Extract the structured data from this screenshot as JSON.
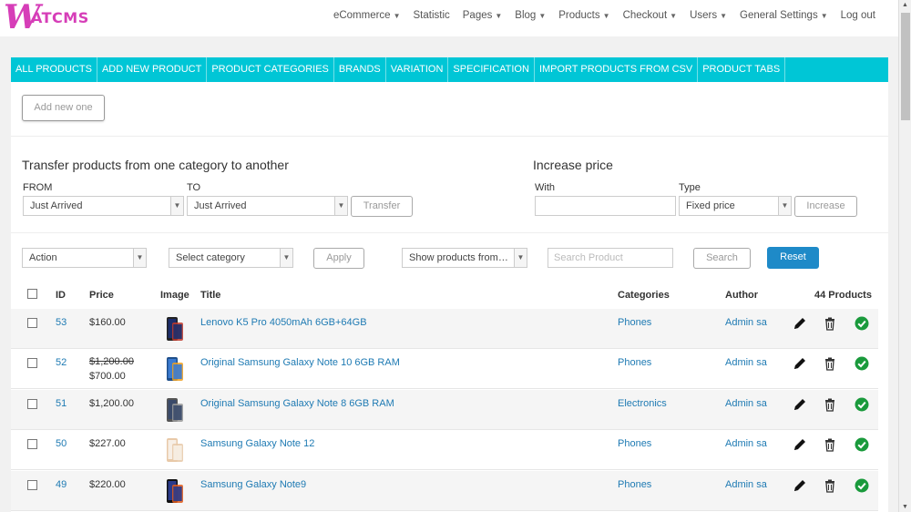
{
  "logo": {
    "initial": "W",
    "rest": "ATCMS"
  },
  "nav": [
    {
      "label": "eCommerce",
      "dropdown": true
    },
    {
      "label": "Statistic",
      "dropdown": false
    },
    {
      "label": "Pages",
      "dropdown": true
    },
    {
      "label": "Blog",
      "dropdown": true
    },
    {
      "label": "Products",
      "dropdown": true
    },
    {
      "label": "Checkout",
      "dropdown": true
    },
    {
      "label": "Users",
      "dropdown": true
    },
    {
      "label": "General Settings",
      "dropdown": true
    },
    {
      "label": "Log out",
      "dropdown": false
    }
  ],
  "tabs": [
    "ALL PRODUCTS",
    "ADD NEW PRODUCT",
    "PRODUCT CATEGORIES",
    "BRANDS",
    "VARIATION",
    "SPECIFICATION",
    "IMPORT PRODUCTS FROM CSV",
    "PRODUCT TABS"
  ],
  "add_new_label": "Add new one",
  "transfer": {
    "title": "Transfer products from one category to another",
    "from_label": "FROM",
    "from_value": "Just Arrived",
    "to_label": "TO",
    "to_value": "Just Arrived",
    "button": "Transfer"
  },
  "increase": {
    "title": "Increase price",
    "with_label": "With",
    "with_value": "",
    "type_label": "Type",
    "type_value": "Fixed price",
    "button": "Increase"
  },
  "filters": {
    "action": "Action",
    "category": "Select category",
    "apply": "Apply",
    "show_from": "Show products from…",
    "search_placeholder": "Search Product",
    "search": "Search",
    "reset": "Reset"
  },
  "table": {
    "headers": {
      "id": "ID",
      "price": "Price",
      "image": "Image",
      "title": "Title",
      "categories": "Categories",
      "author": "Author",
      "count": "44 Products"
    },
    "rows": [
      {
        "id": "53",
        "price": "$160.00",
        "old_price": "",
        "title": "Lenovo K5 Pro 4050mAh 6GB+64GB",
        "category": "Phones",
        "author": "Admin sa",
        "image": "phone-dark"
      },
      {
        "id": "52",
        "price": "$700.00",
        "old_price": "$1,200.00",
        "title": "Original Samsung Galaxy Note 10 6GB RAM",
        "category": "Phones",
        "author": "Admin sa",
        "image": "phone-blue"
      },
      {
        "id": "51",
        "price": "$1,200.00",
        "old_price": "",
        "title": "Original Samsung Galaxy Note 8 6GB RAM",
        "category": "Electronics",
        "author": "Admin sa",
        "image": "phone-grey"
      },
      {
        "id": "50",
        "price": "$227.00",
        "old_price": "",
        "title": "Samsung Galaxy Note 12",
        "category": "Phones",
        "author": "Admin sa",
        "image": "phone-gold"
      },
      {
        "id": "49",
        "price": "$220.00",
        "old_price": "",
        "title": "Samsung Galaxy Note9",
        "category": "Phones",
        "author": "Admin sa",
        "image": "phone-black"
      }
    ]
  },
  "colors": {
    "accent": "#00c6d6",
    "brand": "#d63eb8",
    "link": "#1e7ab3",
    "reset": "#1e8ac8",
    "check": "#1a9a3c"
  }
}
